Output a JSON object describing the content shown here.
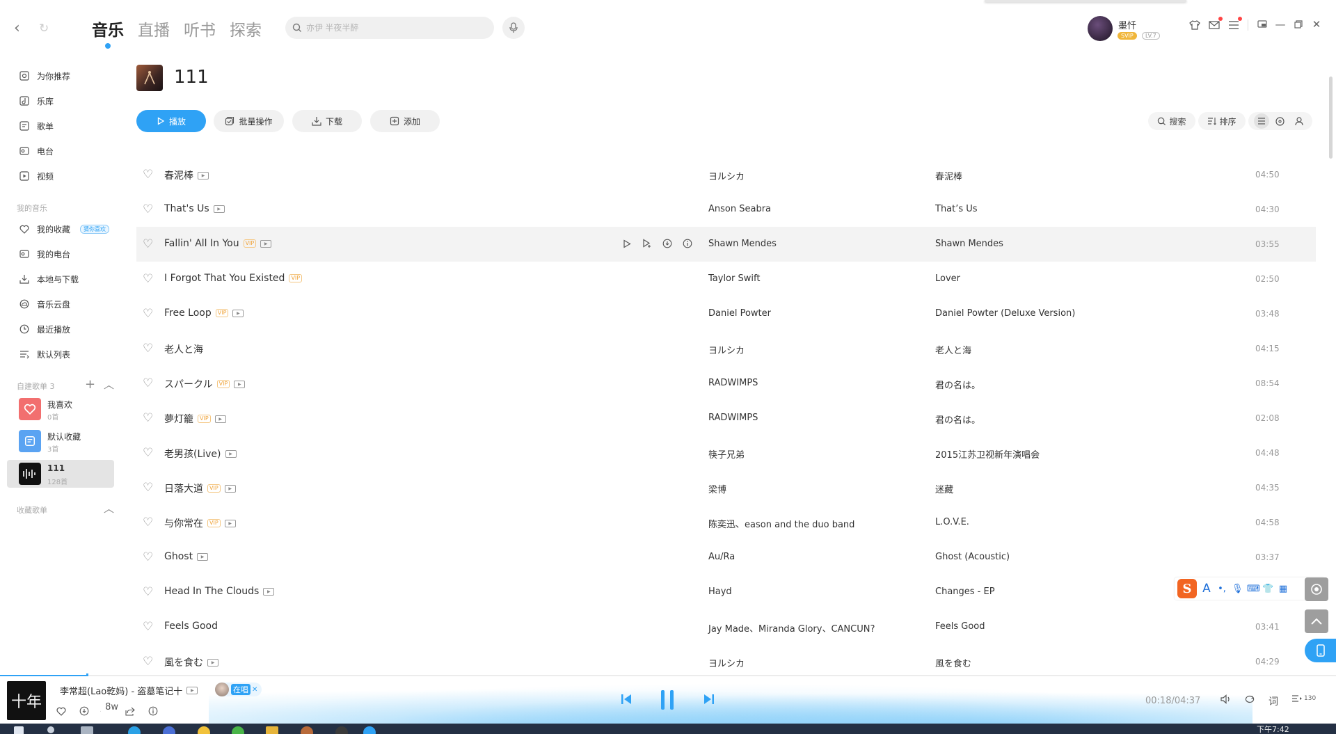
{
  "topbar": {
    "tabs": [
      {
        "label": "音乐",
        "active": true
      },
      {
        "label": "直播",
        "active": false
      },
      {
        "label": "听书",
        "active": false
      },
      {
        "label": "探索",
        "active": false
      }
    ],
    "search_placeholder": "亦伊 半夜半醉",
    "user": {
      "name": "墨忏",
      "svip": "SVIP",
      "level": "LV.7"
    }
  },
  "sidebar": {
    "main_items": [
      {
        "label": "为你推荐",
        "icon": "recommend-icon"
      },
      {
        "label": "乐库",
        "icon": "music-library-icon"
      },
      {
        "label": "歌单",
        "icon": "playlist-icon"
      },
      {
        "label": "电台",
        "icon": "radio-icon"
      },
      {
        "label": "视频",
        "icon": "video-icon"
      }
    ],
    "my_music_title": "我的音乐",
    "my_items": [
      {
        "label": "我的收藏",
        "icon": "heart-icon",
        "tag": "猜你喜欢"
      },
      {
        "label": "我的电台",
        "icon": "radio-icon"
      },
      {
        "label": "本地与下载",
        "icon": "download-icon"
      },
      {
        "label": "音乐云盘",
        "icon": "cloud-icon"
      },
      {
        "label": "最近播放",
        "icon": "clock-icon"
      },
      {
        "label": "默认列表",
        "icon": "list-icon"
      }
    ],
    "created_title": "自建歌单 3",
    "playlists": [
      {
        "name": "我喜欢",
        "count": "0首",
        "color": "#f26f6f"
      },
      {
        "name": "默认收藏",
        "count": "3首",
        "color": "#5aa3f2"
      },
      {
        "name": "111",
        "count": "128首",
        "color": "#111111",
        "active": true
      }
    ],
    "collected_title": "收藏歌单"
  },
  "playlist": {
    "title": "111",
    "actions": {
      "play": "播放",
      "batch": "批量操作",
      "download": "下载",
      "add": "添加"
    },
    "tools": {
      "search": "搜索",
      "sort": "排序"
    }
  },
  "tracks": [
    {
      "title": "春泥棒",
      "vip": false,
      "mv": true,
      "artist": "ヨルシカ",
      "album": "春泥棒",
      "duration": "04:50"
    },
    {
      "title": "That's Us",
      "vip": false,
      "mv": true,
      "artist": "Anson Seabra",
      "album": "That’s Us",
      "duration": "04:30"
    },
    {
      "title": "Fallin' All In You",
      "vip": true,
      "mv": true,
      "artist": "Shawn Mendes",
      "album": "Shawn Mendes",
      "duration": "03:55",
      "hover": true
    },
    {
      "title": "I Forgot That You Existed",
      "vip": true,
      "mv": false,
      "artist": "Taylor Swift",
      "album": "Lover",
      "duration": "02:50"
    },
    {
      "title": "Free Loop",
      "vip": true,
      "mv": true,
      "artist": "Daniel Powter",
      "album": "Daniel Powter (Deluxe Version)",
      "duration": "03:48"
    },
    {
      "title": "老人と海",
      "vip": false,
      "mv": false,
      "artist": "ヨルシカ",
      "album": "老人と海",
      "duration": "04:15"
    },
    {
      "title": "スパークル",
      "vip": true,
      "mv": true,
      "artist": "RADWIMPS",
      "album": "君の名は。",
      "duration": "08:54"
    },
    {
      "title": "夢灯籠",
      "vip": true,
      "mv": true,
      "artist": "RADWIMPS",
      "album": "君の名は。",
      "duration": "02:08"
    },
    {
      "title": "老男孩(Live)",
      "vip": false,
      "mv": true,
      "artist": "筷子兄弟",
      "album": "2015江苏卫视新年演唱会",
      "duration": "04:48"
    },
    {
      "title": "日落大道",
      "vip": true,
      "mv": true,
      "artist": "梁博",
      "album": "迷藏",
      "duration": "04:35"
    },
    {
      "title": "与你常在",
      "vip": true,
      "mv": true,
      "artist": "陈奕迅、eason and the duo band",
      "album": "L.O.V.E.",
      "duration": "04:58"
    },
    {
      "title": "Ghost",
      "vip": false,
      "mv": true,
      "artist": "Au/Ra",
      "album": "Ghost (Acoustic)",
      "duration": "03:37"
    },
    {
      "title": "Head In The Clouds",
      "vip": false,
      "mv": true,
      "artist": "Hayd",
      "album": "Changes - EP",
      "duration": ""
    },
    {
      "title": "Feels Good",
      "vip": false,
      "mv": false,
      "artist": "Jay Made、Miranda Glory、CANCUN?",
      "album": "Feels Good",
      "duration": "03:41"
    },
    {
      "title": "風を食む",
      "vip": false,
      "mv": true,
      "artist": "ヨルシカ",
      "album": "風を食む",
      "duration": "04:29"
    }
  ],
  "player": {
    "now_playing": "李常超(Lao乾妈) - 盗墓笔记十",
    "live_label": "在唱",
    "comment_count": "8w",
    "time": "00:18/04:37",
    "progress": 0.065,
    "lyrics_label": "词",
    "queue_count": "130",
    "cover_text": "十年"
  },
  "ime": {
    "logo": "S",
    "lang": "A"
  },
  "taskbar": {
    "clock": "下午7:42"
  },
  "colors": {
    "accent": "#2fa2f5",
    "vip": "#f0a43a"
  }
}
